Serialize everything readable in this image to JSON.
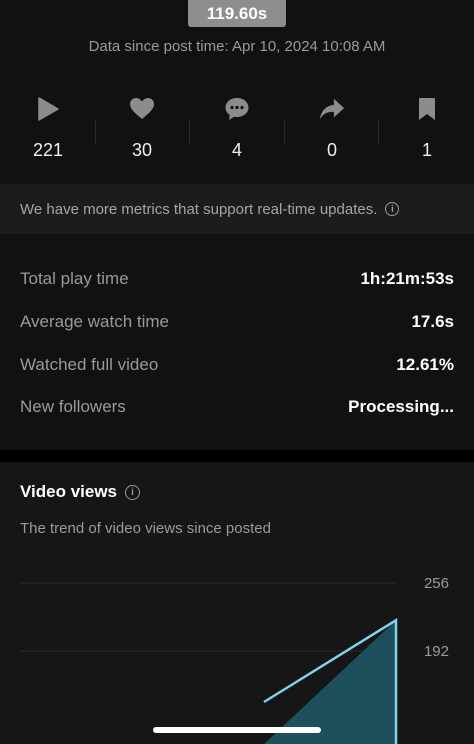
{
  "header": {
    "duration": "119.60s",
    "data_since": "Data since post time: Apr 10, 2024 10:08 AM"
  },
  "stats": [
    {
      "icon": "play-icon",
      "count": "221"
    },
    {
      "icon": "heart-icon",
      "count": "30"
    },
    {
      "icon": "comment-icon",
      "count": "4"
    },
    {
      "icon": "share-icon",
      "count": "0"
    },
    {
      "icon": "bookmark-icon",
      "count": "1"
    }
  ],
  "banner": {
    "text": "We have more metrics that support real-time updates.",
    "icon": "info-icon"
  },
  "metrics": [
    {
      "label": "Total play time",
      "value": "1h:21m:53s"
    },
    {
      "label": "Average watch time",
      "value": "17.6s"
    },
    {
      "label": "Watched full video",
      "value": "12.61%"
    },
    {
      "label": "New followers",
      "value": "Processing..."
    }
  ],
  "video_views": {
    "title": "Video views",
    "subtitle": "The trend of video views since posted"
  },
  "chart_data": {
    "type": "area",
    "title": "Video views",
    "y_ticks": [
      256,
      192
    ],
    "ylim_visible": [
      160,
      256
    ],
    "series": [
      {
        "values": [
          160,
          221
        ]
      }
    ],
    "grid": true,
    "colors": {
      "fill": "#1e4f5c",
      "line": "#7ed3ee"
    }
  },
  "colors": {
    "background": "#111111",
    "card": "#161616",
    "banner": "#1c1c1c",
    "muted_text": "#9a9a9a",
    "chart_line": "#7ed3ee"
  }
}
